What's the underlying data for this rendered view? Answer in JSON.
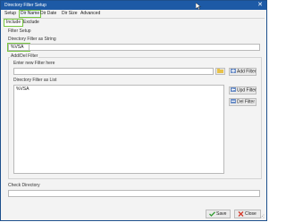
{
  "window": {
    "title": "Directory Filter Setup"
  },
  "menu": {
    "items": [
      "Setup",
      "Dir Name",
      "Dir Date",
      "Dir Size",
      "Advanced"
    ],
    "active": "Dir Name"
  },
  "subtabs": {
    "items": [
      "Include",
      "Exclude"
    ],
    "active": "Include"
  },
  "filter_setup": {
    "group_label": "Filter Setup",
    "string_label": "Directory Filter as String",
    "string_value": "%VSA"
  },
  "add_del_filter": {
    "group_label": "Add/Del Filter",
    "new_filter_label": "Enter new Filter here",
    "new_filter_value": "",
    "add_button": "Add Filter",
    "list_label": "Directory Filter as List",
    "list_items": [
      "%VSA"
    ],
    "upd_button": "Upd Filter",
    "del_button": "Del Filter"
  },
  "check_directory": {
    "label": "Check Directory",
    "value": ""
  },
  "footer": {
    "save_button": "Save",
    "close_button": "Close"
  },
  "colors": {
    "titlebar": "#1d5aa6",
    "highlight": "#78c640",
    "save_icon": "#2f9a2f",
    "close_icon": "#d23b2b"
  }
}
